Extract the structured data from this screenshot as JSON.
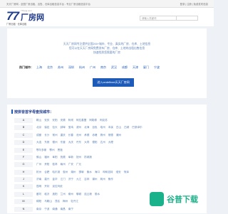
{
  "topbar": {
    "left": "天天厂房网 - 全国厂房出租、出售、仓库出租信息平台 - 专业厂房出租信息平台",
    "right": "登录 | 注册 | 免费发布信息"
  },
  "logo": {
    "mark": "77",
    "name": "厂房网",
    "url": "77fang.com",
    "tagline": "厂房出租 · 仓库出租"
  },
  "search": {
    "placeholder": "请输入关键词"
  },
  "hero": {
    "lines": [
      "天天厂房网专注提供全国200+城市、专业、真实的厂房、仓库、土地信息",
      "您可以在天天厂房网免费发布厂房、仓库、土地的出租出售信息",
      "快速找到您需要的厂房"
    ],
    "hot_label": "热门城市：",
    "hot_cities": [
      "上海",
      "北京",
      "苏州",
      "深圳",
      "杭州",
      "广州",
      "南京",
      "武汉",
      "成都",
      "天津",
      "厦门",
      "宁波"
    ],
    "cta": "进入undefined天天厂房网"
  },
  "list": {
    "title": "按拼音首字母查找城市：",
    "rows": [
      {
        "letter": "A",
        "cities": [
          "鞍山",
          "安庆",
          "安阳",
          "安顺",
          "阿坝",
          "阿拉善盟",
          "阿勒泰",
          "阿克苏"
        ]
      },
      {
        "letter": "B",
        "cities": [
          "北京",
          "保定",
          "包头",
          "蚌埠",
          "宝鸡",
          "滨州",
          "北海",
          "百色",
          "亳州",
          "本溪",
          "白山",
          "白城",
          "巴彦淖尔"
        ]
      },
      {
        "letter": "C",
        "cities": [
          "成都",
          "长沙",
          "常州",
          "重庆",
          "长春",
          "沧州",
          "承德",
          "赤峰",
          "滁州",
          "常德",
          "潮州"
        ]
      },
      {
        "letter": "D",
        "cities": [
          "大连",
          "东莞",
          "德州",
          "东营",
          "大庆",
          "丹东",
          "大同",
          "德阳",
          "达州",
          "大理"
        ]
      },
      {
        "letter": "E",
        "cities": [
          "鄂尔多斯",
          "鄂州",
          "恩施"
        ]
      },
      {
        "letter": "F",
        "cities": [
          "佛山",
          "福州",
          "阜阳",
          "抚顺",
          "阜新",
          "抚州",
          "防城港"
        ]
      },
      {
        "letter": "G",
        "cities": [
          "广州",
          "贵阳",
          "桂林",
          "赣州",
          "广安",
          "广元"
        ]
      },
      {
        "letter": "H",
        "cities": [
          "杭州",
          "合肥",
          "哈尔滨",
          "惠州",
          "湖州",
          "邯郸",
          "衡水",
          "海口",
          "呼和浩特",
          "淮安",
          "菏泽"
        ]
      },
      {
        "letter": "J",
        "cities": [
          "济南",
          "嘉兴",
          "金华",
          "江门",
          "济宁",
          "九江",
          "吉林",
          "锦州",
          "荆州",
          "焦作"
        ]
      },
      {
        "letter": "K",
        "cities": [
          "昆明",
          "开封",
          "克拉玛依"
        ]
      },
      {
        "letter": "L",
        "cities": [
          "廊坊",
          "临沂",
          "洛阳",
          "兰州",
          "柳州",
          "聊城",
          "连云港",
          "丽水"
        ]
      },
      {
        "letter": "M",
        "cities": [
          "绵阳",
          "马鞍山",
          "茂名",
          "梅州",
          "牡丹江"
        ]
      },
      {
        "letter": "N",
        "cities": [
          "南京",
          "宁波",
          "南通",
          "南昌",
          "南宁"
        ]
      }
    ]
  },
  "watermark": {
    "text": "谷普下载"
  }
}
